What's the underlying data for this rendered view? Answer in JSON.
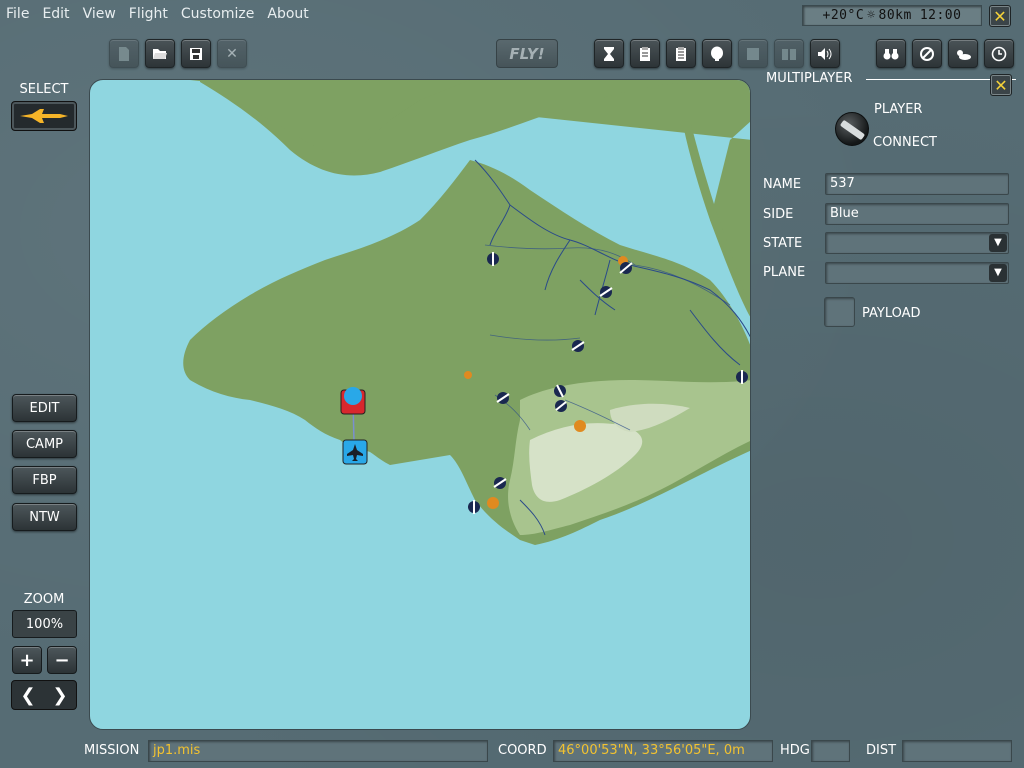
{
  "menu": [
    "File",
    "Edit",
    "View",
    "Flight",
    "Customize",
    "About"
  ],
  "weather": {
    "temperature": "+20°C",
    "sun_icon": "☼",
    "visibility": "80km",
    "time": "12:00"
  },
  "toolbar": {
    "file_icons": [
      "new-file-icon",
      "open-folder-icon",
      "save-disk-icon",
      "close-x-icon"
    ],
    "fly_label": "FLY!",
    "view_icons": [
      "hourglass-icon",
      "briefing-icon",
      "checklist-icon",
      "pilot-head-icon",
      "map-page-icon",
      "book-icon",
      "speaker-icon"
    ],
    "right_icons": [
      "binoculars-icon",
      "no-entry-icon",
      "weather-cloud-icon",
      "clock-icon"
    ]
  },
  "left_panel": {
    "select_label": "SELECT",
    "buttons": [
      "EDIT",
      "CAMP",
      "FBP",
      "NTW"
    ],
    "zoom_label": "ZOOM",
    "zoom_value": "100%",
    "zoom_in": "+",
    "zoom_out": "−",
    "pan_left": "❮",
    "pan_right": "❯"
  },
  "multiplayer": {
    "title": "MULTIPLAYER",
    "option_player": "PLAYER",
    "option_connect": "CONNECT",
    "name_label": "NAME",
    "name_value": "537",
    "side_label": "SIDE",
    "side_value": "Blue",
    "state_label": "STATE",
    "state_value": "",
    "plane_label": "PLANE",
    "plane_value": "",
    "payload_label": "PAYLOAD"
  },
  "status": {
    "mission_label": "MISSION",
    "mission_value": "jp1.mis",
    "coord_label": "COORD",
    "coord_value": "46°00'53\"N, 33°56'05\"E, 0m",
    "hdg_label": "HDG",
    "hdg_value": "",
    "dist_label": "DIST",
    "dist_value": ""
  },
  "colors": {
    "sea": "#8fd6e0",
    "land": "#7ea162",
    "mountains": "#c8d8b8",
    "accent_yellow": "#f5d23a",
    "status_text": "#f2c230",
    "player_blue": "#29a8e8",
    "enemy_red": "#d8282d"
  }
}
